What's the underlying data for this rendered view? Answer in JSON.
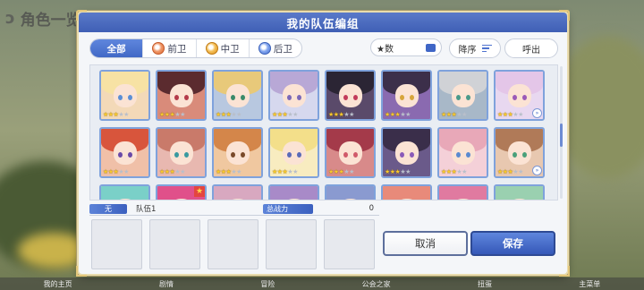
{
  "background": {
    "title": "角色一览",
    "bottom_nav": [
      "我的主页",
      "剧情",
      "冒险",
      "公会之家",
      "扭蛋",
      "主菜单"
    ]
  },
  "modal": {
    "title": "我的队伍编组"
  },
  "filters": {
    "tabs": [
      {
        "label": "全部",
        "active": true
      },
      {
        "label": "前卫",
        "active": false,
        "icon": "vanguard-icon"
      },
      {
        "label": "中卫",
        "active": false,
        "icon": "midguard-icon"
      },
      {
        "label": "后卫",
        "active": false,
        "icon": "rearguard-icon"
      }
    ],
    "stars_button": "★数",
    "sort_button": "降序",
    "call_button": "呼出"
  },
  "characters": [
    {
      "stars": 3,
      "hair": "#f7e2a4",
      "eye": "#5b8ed6",
      "bg": "#f3d9b8"
    },
    {
      "stars": 3,
      "hair": "#5b2b2f",
      "eye": "#b43a4a",
      "bg": "#d98b7a"
    },
    {
      "stars": 3,
      "hair": "#e8c97a",
      "eye": "#3a8a6a",
      "bg": "#b8c8e0"
    },
    {
      "stars": 3,
      "hair": "#b8a8d6",
      "eye": "#7a68b8",
      "bg": "#d6d8ee"
    },
    {
      "stars": 3,
      "hair": "#2b2534",
      "eye": "#c23a5a",
      "bg": "#5a4a6a"
    },
    {
      "stars": 3,
      "hair": "#3c2f4a",
      "eye": "#d6a53a",
      "bg": "#8a6ab0"
    },
    {
      "stars": 3,
      "hair": "#d0d2d6",
      "eye": "#4a9a8a",
      "bg": "#a8b8c8"
    },
    {
      "stars": 3,
      "hair": "#e4c6e8",
      "eye": "#9a5ab8",
      "bg": "#e8d8f0"
    },
    {
      "stars": 3,
      "hair": "#d8553c",
      "eye": "#6a4aa8",
      "bg": "#f0c0a8"
    },
    {
      "stars": 3,
      "hair": "#c97a6a",
      "eye": "#3a9aa0",
      "bg": "#e8b8b0"
    },
    {
      "stars": 3,
      "hair": "#d4864a",
      "eye": "#7a4a2a",
      "bg": "#f0c8a0"
    },
    {
      "stars": 3,
      "hair": "#f3df8a",
      "eye": "#5a6ab8",
      "bg": "#f8ecc0"
    },
    {
      "stars": 3,
      "hair": "#a43a4a",
      "eye": "#d05a6a",
      "bg": "#d88a8a"
    },
    {
      "stars": 3,
      "hair": "#3a2e4a",
      "eye": "#8a5ab8",
      "bg": "#6a5a8a"
    },
    {
      "stars": 3,
      "hair": "#e8a8b8",
      "eye": "#5a8ad0",
      "bg": "#f4d0d8"
    },
    {
      "stars": 3,
      "hair": "#b07a58",
      "eye": "#4aa07a",
      "bg": "#e8c8b0"
    },
    {
      "stars": 3,
      "hair": "#7ad0c8",
      "eye": "#3a6ab8",
      "bg": "#c8e8e8"
    },
    {
      "stars": 3,
      "hair": "#e0508a",
      "eye": "#b03a6a",
      "bg": "#f0a8c0"
    },
    {
      "stars": 3,
      "hair": "#d8a8c0",
      "eye": "#6a4a8a",
      "bg": "#f0d0e0"
    },
    {
      "stars": 3,
      "hair": "#a88ac8",
      "eye": "#5a3a8a",
      "bg": "#d0c0e8"
    },
    {
      "stars": 3,
      "hair": "#8a9ad0",
      "eye": "#3a4a8a",
      "bg": "#b8c0e0"
    },
    {
      "stars": 3,
      "hair": "#e88a7a",
      "eye": "#8a3a3a",
      "bg": "#f0b8a8"
    },
    {
      "stars": 3,
      "hair": "#e07aa0",
      "eye": "#5a8ad0",
      "bg": "#f0c0d0"
    },
    {
      "stars": 3,
      "hair": "#9ad0b0",
      "eye": "#3a7a5a",
      "bg": "#d0e8d8"
    }
  ],
  "party": {
    "tag": "无",
    "name": "队伍1",
    "power_label": "总战力",
    "power_value": "0"
  },
  "buttons": {
    "cancel": "取消",
    "save": "保存"
  }
}
